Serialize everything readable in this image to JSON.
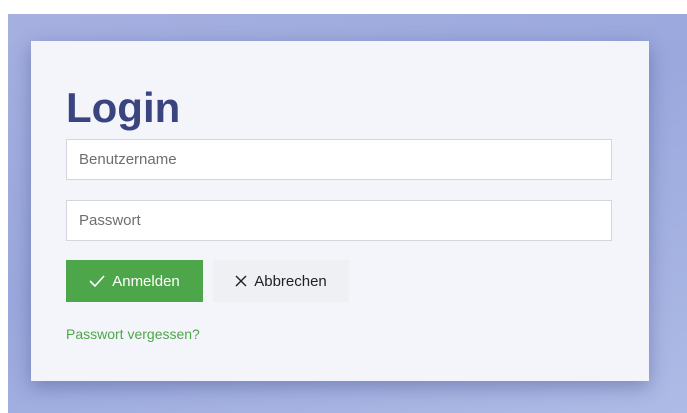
{
  "login": {
    "title": "Login",
    "username": {
      "placeholder": "Benutzername",
      "value": ""
    },
    "password": {
      "placeholder": "Passwort",
      "value": ""
    },
    "submit_label": "Anmelden",
    "submit_icon": "check-icon",
    "cancel_label": "Abbrechen",
    "cancel_icon": "close-icon",
    "forgot_link": "Passwort vergessen?"
  },
  "colors": {
    "title": "#3a4580",
    "accent_green": "#4ea64a",
    "background": "#9aa8dd",
    "card": "#f3f5fa"
  }
}
